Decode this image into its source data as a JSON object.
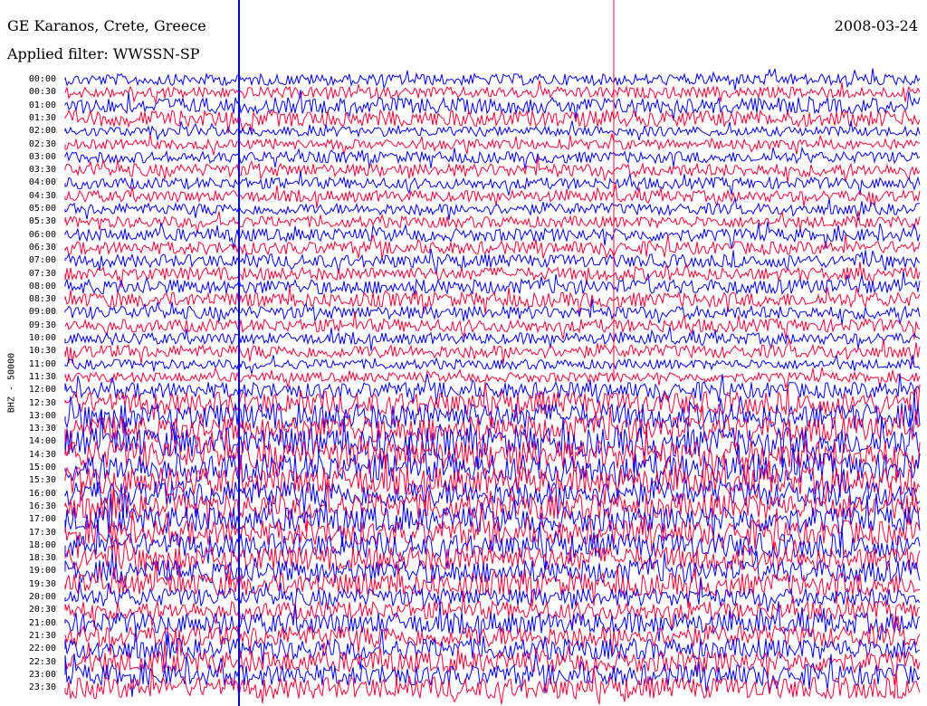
{
  "header": {
    "title": "GE Karanos, Crete, Greece",
    "filter": "Applied filter: WWSSN-SP",
    "date": "2008-03-24"
  },
  "chart_data": {
    "type": "line",
    "ylabel": "BHZ - 50000",
    "row_labels": [
      "00:00",
      "00:30",
      "01:00",
      "01:30",
      "02:00",
      "02:30",
      "03:00",
      "03:30",
      "04:00",
      "04:30",
      "05:00",
      "05:30",
      "06:00",
      "06:30",
      "07:00",
      "07:30",
      "08:00",
      "08:30",
      "09:00",
      "09:30",
      "10:00",
      "10:30",
      "11:00",
      "11:30",
      "12:00",
      "12:30",
      "13:00",
      "13:30",
      "14:00",
      "14:30",
      "15:00",
      "15:30",
      "16:00",
      "16:30",
      "17:00",
      "17:30",
      "18:00",
      "18:30",
      "19:00",
      "19:30",
      "20:00",
      "20:30",
      "21:00",
      "21:30",
      "22:00",
      "22:30",
      "23:00",
      "23:30"
    ],
    "row_label_display": [
      "00:00",
      "00:30",
      "01:00",
      "01:30",
      "02:00",
      "02:30",
      "03:00",
      "03:30",
      "04:00",
      "04:30",
      "05:00",
      "05:30",
      "06:00",
      "06:30",
      "07:00",
      "07:30",
      "08:00",
      "08:30",
      "09:00",
      "09:30",
      "10:00",
      "10:30",
      "11:00",
      "11:30",
      "12:00",
      "12:30",
      "13:00",
      "13:30",
      "14:00",
      "14:30",
      "15:00",
      "15:30",
      "16:00",
      "16:30",
      "17:00",
      "17:30",
      "18:00",
      "18:30",
      "19:00",
      "19:30",
      "20:00",
      "20:30",
      "21:00",
      "21:30",
      "22:00",
      "22:30",
      "23:00",
      "23:30"
    ],
    "series_colors": [
      "#0000ff",
      "#ff0033"
    ],
    "row_amplitude": [
      0.7,
      0.7,
      1.0,
      1.0,
      0.6,
      0.6,
      0.7,
      0.8,
      0.7,
      0.7,
      0.7,
      0.7,
      0.8,
      0.8,
      0.8,
      0.8,
      0.9,
      0.9,
      0.8,
      0.8,
      0.7,
      0.8,
      0.6,
      0.6,
      1.0,
      1.4,
      1.6,
      1.6,
      1.8,
      1.8,
      1.8,
      1.7,
      1.6,
      1.6,
      1.6,
      1.5,
      1.5,
      1.5,
      1.4,
      1.4,
      1.1,
      1.1,
      1.3,
      1.3,
      1.3,
      1.3,
      1.3,
      1.3
    ]
  }
}
